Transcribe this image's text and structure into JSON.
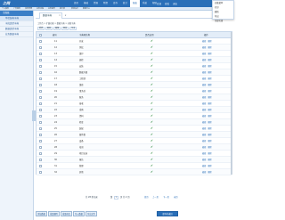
{
  "header": {
    "logo": "之网",
    "nav": [
      "首页",
      "基础",
      "资源",
      "物资",
      "库存",
      "统计",
      "报表",
      "系统",
      "帮助"
    ],
    "nav_active_index": 6,
    "user_links": [
      "欢迎",
      "修改",
      "退出"
    ]
  },
  "subbar": {
    "items": [
      "个人事务",
      "广告服务",
      "任务管理",
      "业务流程",
      "业务操作",
      "统计表",
      "表单设计",
      "数据中心"
    ]
  },
  "sidebar": {
    "title": "主面板",
    "items": [
      "单位结构字典",
      "字段类型字典",
      "数据类型字典",
      "业务数据字典"
    ],
    "selected_index": 0
  },
  "tab": {
    "label": "数据字典"
  },
  "dropdown": {
    "items": [
      "功能菜单",
      "打印",
      "刷新",
      "导出",
      "全部关闭"
    ]
  },
  "breadcrumb": "工作台 > 扩展功能 > 数据字典 > 功能字典",
  "actions": [
    "新增",
    "删除",
    "编辑",
    "查询",
    "导出"
  ],
  "grid": {
    "columns": [
      "编号",
      "字典项名称",
      "是否启用",
      "操作"
    ],
    "rows": [
      {
        "id": "11",
        "name": "开发",
        "enabled": true
      },
      {
        "id": "12",
        "name": "测试",
        "enabled": true
      },
      {
        "id": "13",
        "name": "维护",
        "enabled": true
      },
      {
        "id": "14",
        "name": "巡检",
        "enabled": true
      },
      {
        "id": "15",
        "name": "安装",
        "enabled": true
      },
      {
        "id": "16",
        "name": "数据升级",
        "enabled": true
      },
      {
        "id": "17",
        "name": "工程部",
        "enabled": true
      },
      {
        "id": "18",
        "name": "维修",
        "enabled": true
      },
      {
        "id": "19",
        "name": "事务处",
        "enabled": true
      },
      {
        "id": "20",
        "name": "服务",
        "enabled": true
      },
      {
        "id": "21",
        "name": "接收",
        "enabled": true
      },
      {
        "id": "22",
        "name": "采购",
        "enabled": true
      },
      {
        "id": "23",
        "name": "资料",
        "enabled": true
      },
      {
        "id": "24",
        "name": "检查",
        "enabled": true
      },
      {
        "id": "25",
        "name": "装配",
        "enabled": true
      },
      {
        "id": "26",
        "name": "备件数",
        "enabled": true
      },
      {
        "id": "27",
        "name": "设备",
        "enabled": true
      },
      {
        "id": "28",
        "name": "培训",
        "enabled": true
      },
      {
        "id": "29",
        "name": "项目记录",
        "enabled": true
      },
      {
        "id": "30",
        "name": "报告",
        "enabled": true
      },
      {
        "id": "31",
        "name": "管理",
        "enabled": true
      },
      {
        "id": "32",
        "name": "其他",
        "enabled": true
      }
    ],
    "op_labels": [
      "编辑",
      "删除"
    ]
  },
  "pager": {
    "summary": "共 28 条记录",
    "page_label": "第",
    "page_value": "1",
    "of_label": "页 共 2 页",
    "first": "首页",
    "prev": "上一页",
    "next": "下一页",
    "last": "末页"
  },
  "bottom_buttons": [
    "添加数据",
    "批量删除",
    "批量修改",
    "导入数据",
    "导出文件"
  ],
  "bottom_right_button": "保存并返回",
  "colors": {
    "brand": "#2a6fb8",
    "ok": "#2e8b3e",
    "border": "#c7d7ea"
  }
}
